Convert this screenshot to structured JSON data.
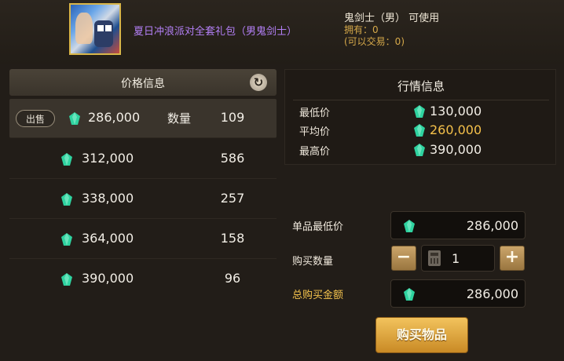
{
  "item": {
    "name": "夏日冲浪派对全套礼包（男鬼剑士）",
    "class_req": "鬼剑士（男） 可使用",
    "owned": "拥有：0",
    "tradeable": "(可以交易：0)"
  },
  "price_panel": {
    "title": "价格信息",
    "sell_label": "出售",
    "qty_label": "数量",
    "listings": [
      {
        "price": "286,000",
        "qty": "109"
      },
      {
        "price": "312,000",
        "qty": "586"
      },
      {
        "price": "338,000",
        "qty": "257"
      },
      {
        "price": "364,000",
        "qty": "158"
      },
      {
        "price": "390,000",
        "qty": "96"
      }
    ]
  },
  "market_panel": {
    "title": "行情信息",
    "stats": [
      {
        "label": "最低价",
        "value": "130,000"
      },
      {
        "label": "平均价",
        "value": "260,000"
      },
      {
        "label": "最高价",
        "value": "390,000"
      }
    ]
  },
  "purchase": {
    "unit_price_label": "单品最低价",
    "unit_price": "286,000",
    "qty_label": "购买数量",
    "qty": "1",
    "minus": "−",
    "plus": "+",
    "total_label": "总购买金额",
    "total": "286,000",
    "buy_label": "购买物品"
  },
  "colors": {
    "gem": "#2fd3a0",
    "gold_text": "#f4c04a",
    "item_name": "#b37ff5"
  }
}
